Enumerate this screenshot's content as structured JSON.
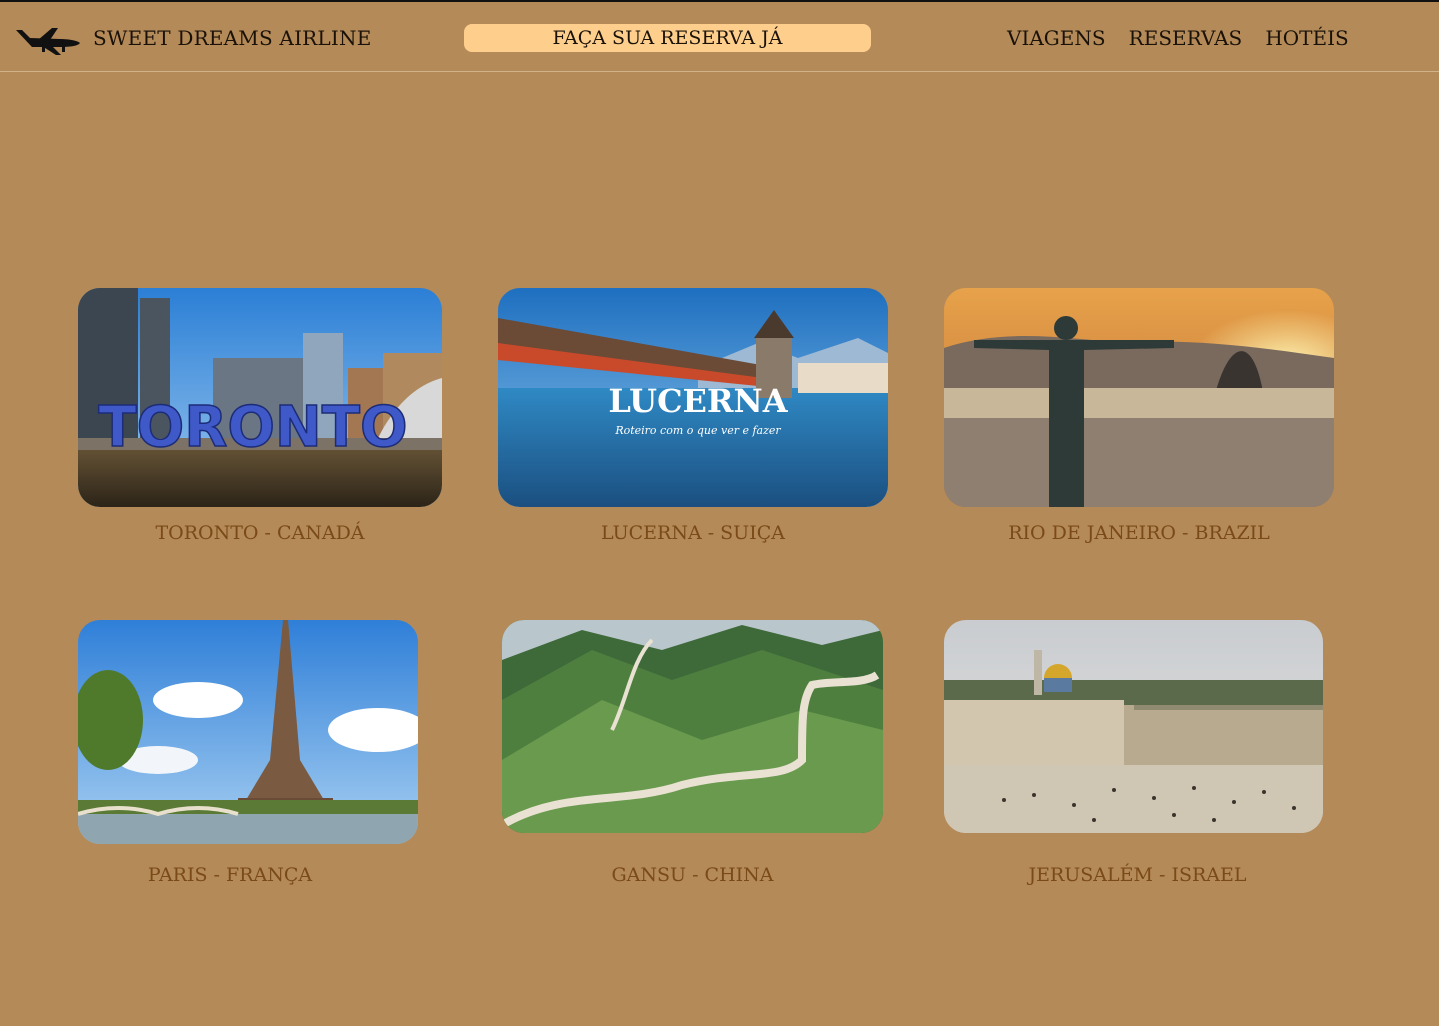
{
  "header": {
    "brand": "SWEET DREAMS AIRLINE",
    "logo_icon": "airplane-icon",
    "cta_label": "FAÇA SUA RESERVA JÁ",
    "nav": [
      "VIAGENS",
      "RESERVAS",
      "HOTÉIS"
    ]
  },
  "colors": {
    "background": "#b48a58",
    "cta_background": "#fecf8c",
    "caption": "#7a4a18",
    "header_text": "#1a1209"
  },
  "destinations": [
    {
      "caption": "TORONTO - CANADÁ",
      "image": "toronto-sign-photo",
      "image_text": "TORONTO"
    },
    {
      "caption": "LUCERNA - SUIÇA",
      "image": "lucerne-chapel-bridge-photo",
      "image_text": "LUCERNA",
      "image_subtext": "Roteiro com o que ver e fazer"
    },
    {
      "caption": "RIO DE JANEIRO - BRAZIL",
      "image": "christ-the-redeemer-sunset-photo"
    },
    {
      "caption": "PARIS - FRANÇA",
      "image": "eiffel-tower-photo"
    },
    {
      "caption": "GANSU - CHINA",
      "image": "great-wall-photo"
    },
    {
      "caption": "JERUSALÉM - ISRAEL",
      "image": "western-wall-plaza-photo"
    }
  ]
}
